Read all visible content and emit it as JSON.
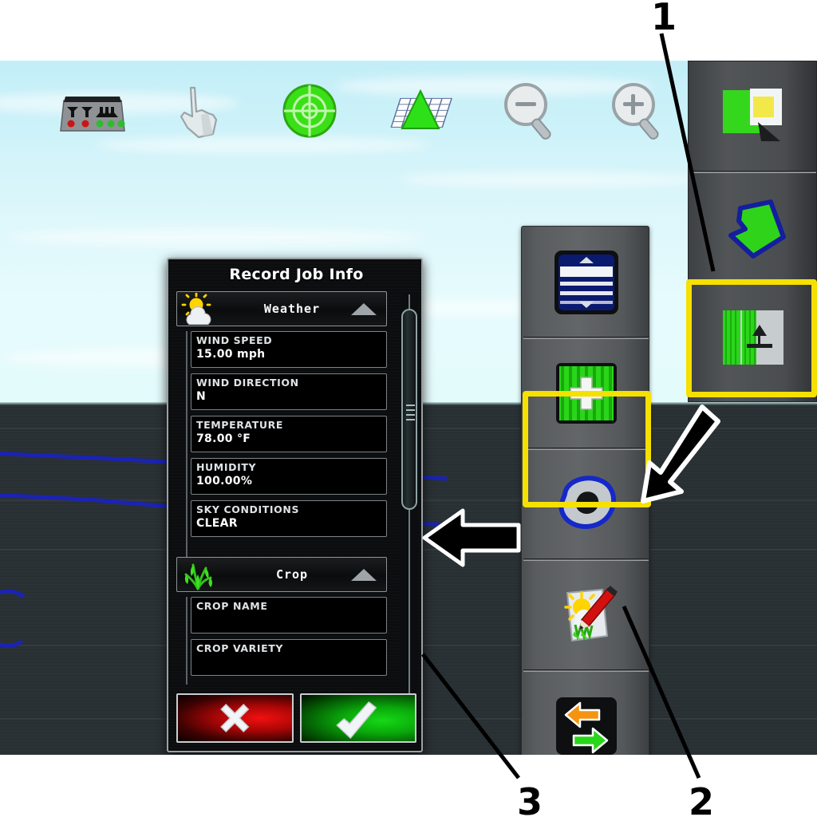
{
  "app": {
    "name": "agricultural-display-map-view"
  },
  "top_toolbar": {
    "items": [
      {
        "id": "sections-status",
        "icon": "implement-sections-icon",
        "label": "Implement Sections Status"
      },
      {
        "id": "pointer",
        "icon": "hand-pointer-icon",
        "label": "Pointer / Pan"
      },
      {
        "id": "gps-target",
        "icon": "gps-target-icon",
        "label": "GPS Target"
      },
      {
        "id": "perspective-view",
        "icon": "grid-perspective-icon",
        "label": "Perspective View"
      },
      {
        "id": "zoom-out",
        "icon": "magnifier-minus-icon",
        "label": "Zoom Out"
      },
      {
        "id": "zoom-in",
        "icon": "magnifier-plus-icon",
        "label": "Zoom In"
      }
    ]
  },
  "center_toolbar": {
    "items": [
      {
        "id": "guidance-lines",
        "icon": "blue-striped-lines-icon",
        "label": "Guidance Lines",
        "selected": false
      },
      {
        "id": "add-coverage",
        "icon": "green-plus-field-icon",
        "label": "Add Coverage",
        "selected": false
      },
      {
        "id": "boundary-region",
        "icon": "blue-blob-boundary-icon",
        "label": "Boundary / Region",
        "selected": false
      },
      {
        "id": "record-job-info",
        "icon": "weather-notepad-pencil-icon",
        "label": "Record Job Info",
        "selected": true
      },
      {
        "id": "swap-transfer",
        "icon": "orange-green-swap-arrows-icon",
        "label": "Swap / Transfer",
        "selected": false
      }
    ]
  },
  "right_panel": {
    "items": [
      {
        "id": "coverage-map",
        "icon": "green-coverage-map-icon",
        "label": "Coverage Map",
        "selected": false
      },
      {
        "id": "field-boundary",
        "icon": "green-field-polygon-icon",
        "label": "Field Boundary",
        "selected": false
      },
      {
        "id": "split-screen-view",
        "icon": "split-screen-vehicle-icon",
        "label": "Split Screen View",
        "selected": true
      }
    ]
  },
  "dialog": {
    "title": "Record Job Info",
    "sections": [
      {
        "id": "weather",
        "label": "Weather",
        "icon": "sun-cloud-icon",
        "expanded": true,
        "caret": "caret-up-icon",
        "fields": [
          {
            "label": "WIND SPEED",
            "value": "15.00 mph"
          },
          {
            "label": "WIND DIRECTION",
            "value": "N"
          },
          {
            "label": "TEMPERATURE",
            "value": "78.00 °F"
          },
          {
            "label": "HUMIDITY",
            "value": "100.00%"
          },
          {
            "label": "SKY CONDITIONS",
            "value": "CLEAR"
          }
        ]
      },
      {
        "id": "crop",
        "label": "Crop",
        "icon": "green-plant-icon",
        "expanded": true,
        "caret": "caret-up-icon",
        "fields": [
          {
            "label": "CROP NAME",
            "value": ""
          },
          {
            "label": "CROP VARIETY",
            "value": ""
          }
        ]
      }
    ],
    "buttons": [
      {
        "id": "cancel",
        "icon": "x-mark-icon",
        "color": "#e00000",
        "label": "Cancel"
      },
      {
        "id": "accept",
        "icon": "check-mark-icon",
        "color": "#0cbb0c",
        "label": "Accept"
      }
    ],
    "scrollbar": {
      "orientation": "vertical",
      "thumb_position_pct": 5
    }
  },
  "annotations": {
    "highlight_color": "#f5e000",
    "callouts": [
      {
        "number": "1",
        "target": "split-screen-view-button"
      },
      {
        "number": "2",
        "target": "record-job-info-button"
      },
      {
        "number": "3",
        "target": "record-job-info-dialog"
      }
    ],
    "arrows": [
      {
        "id": "arrow-to-dialog",
        "direction": "left",
        "target": "record-job-info-dialog"
      },
      {
        "id": "arrow-to-record-button",
        "direction": "down-left",
        "target": "record-job-info-button"
      }
    ]
  }
}
